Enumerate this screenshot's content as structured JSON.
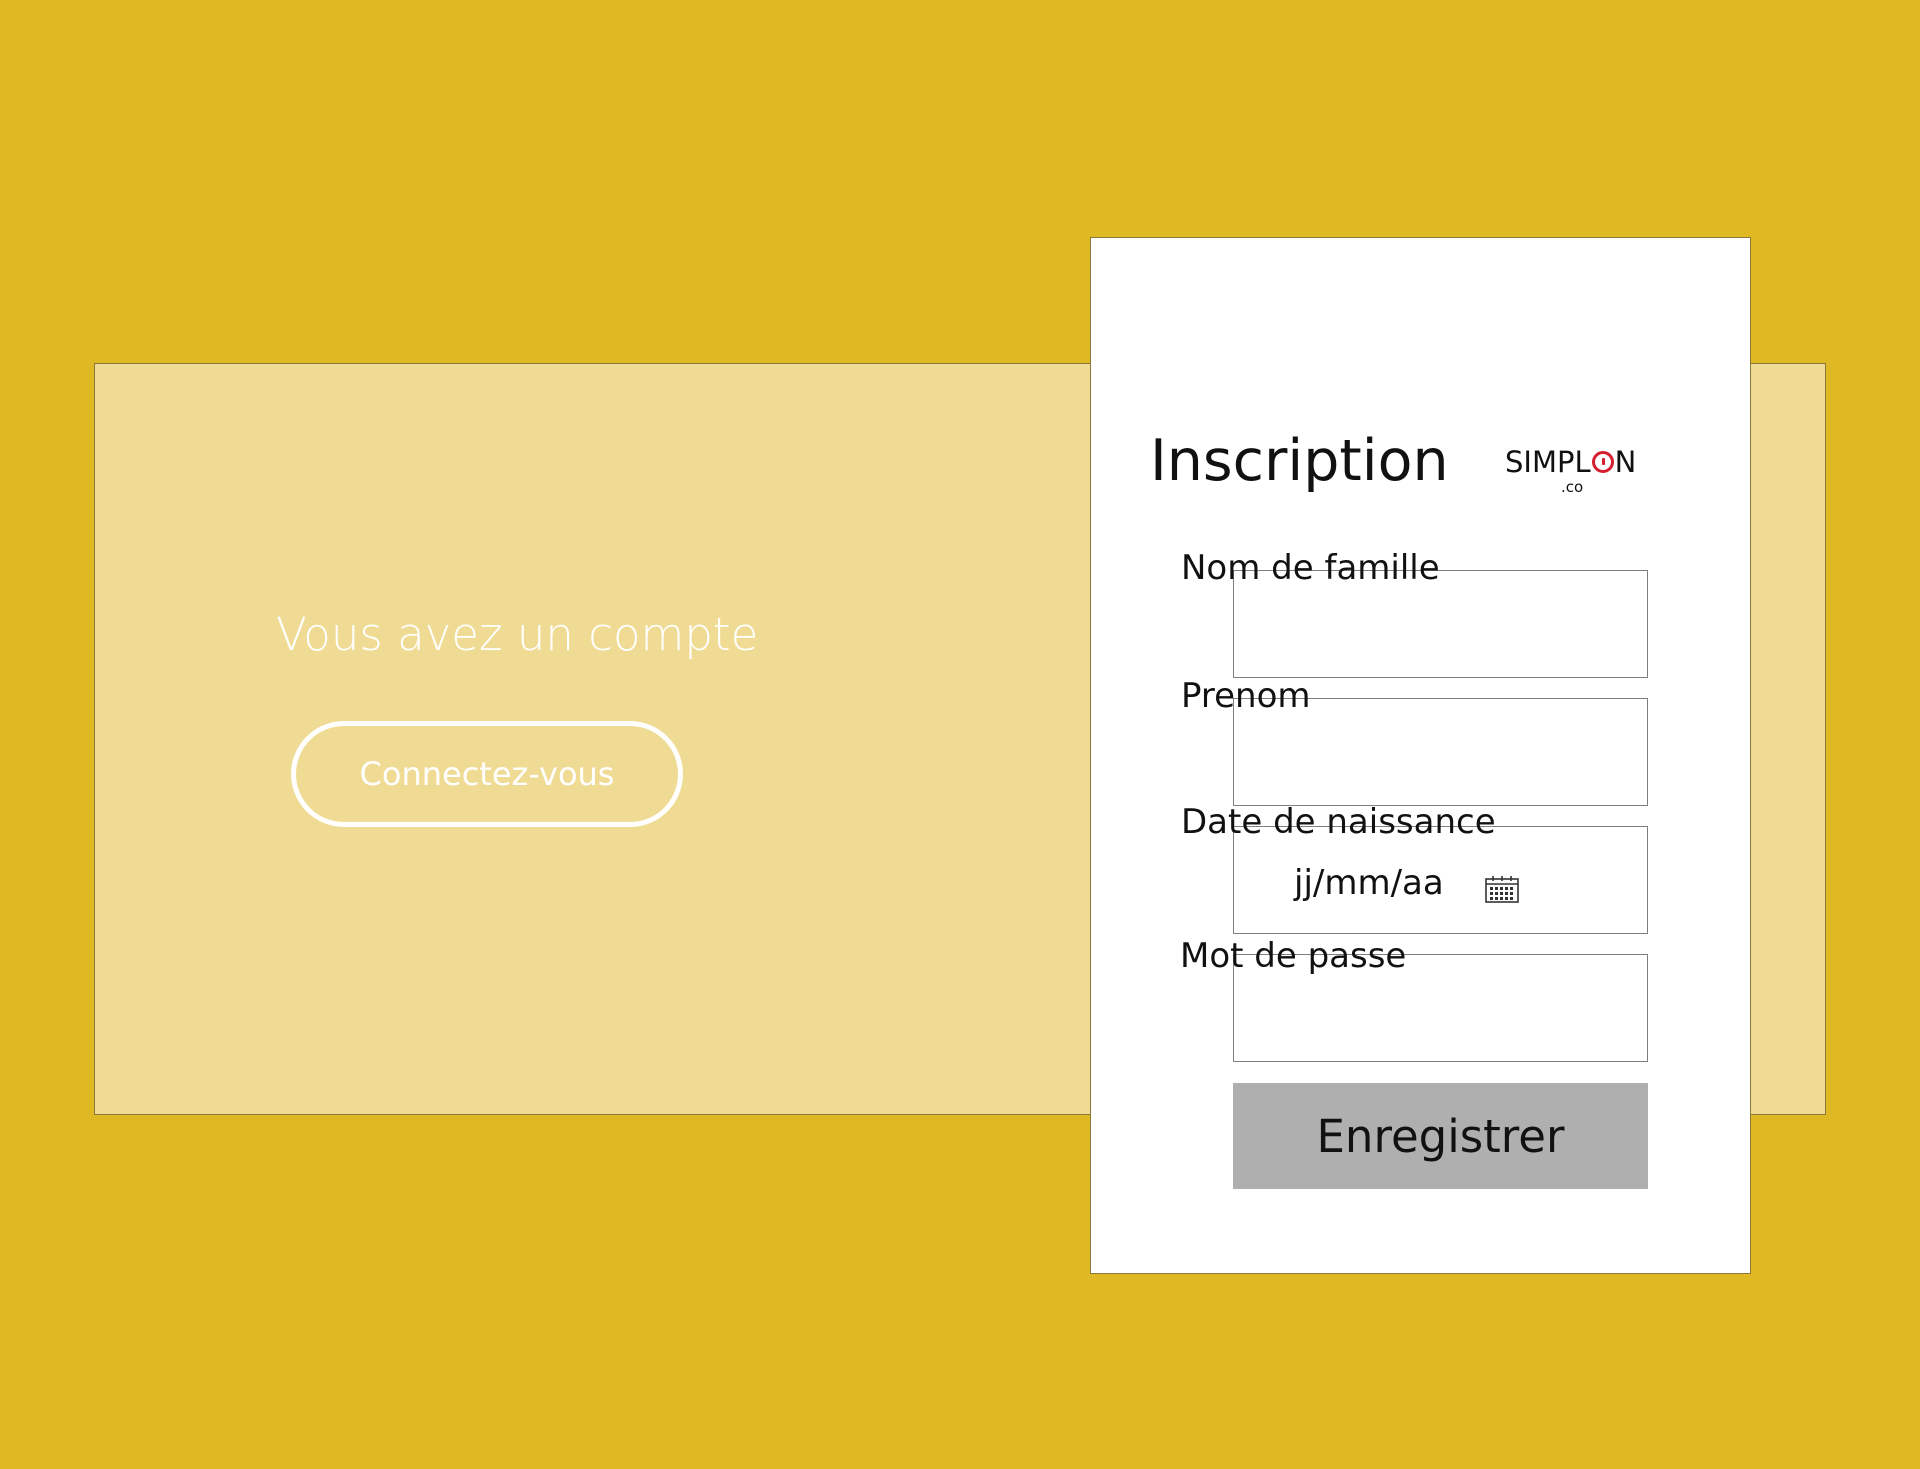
{
  "background_color": "#DFB823",
  "login_panel": {
    "prompt": "Vous avez un compte",
    "button_label": "Connectez-vous"
  },
  "signup_card": {
    "title": "Inscription",
    "logo": {
      "word_before": "SIMPL",
      "word_after": "N",
      "suffix": ".co",
      "accent_color": "#D6202F"
    },
    "fields": {
      "last_name": {
        "label": "Nom de famille",
        "value": ""
      },
      "first_name": {
        "label": "Prenom",
        "value": ""
      },
      "birth_date": {
        "label": "Date de naissance",
        "placeholder": "jj/mm/aa"
      },
      "password": {
        "label": "Mot de passe",
        "value": ""
      }
    },
    "submit_label": "Enregistrer",
    "submit_color": "#AFAFAF"
  }
}
